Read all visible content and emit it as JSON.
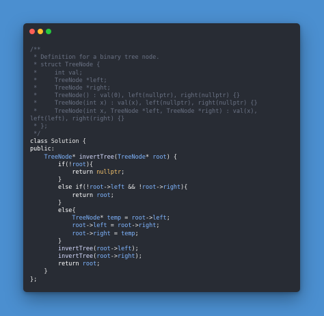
{
  "code_lines": [
    [
      {
        "t": "/**",
        "c": "cm"
      }
    ],
    [
      {
        "t": " * Definition for a binary tree node.",
        "c": "cm"
      }
    ],
    [
      {
        "t": " * struct TreeNode {",
        "c": "cm"
      }
    ],
    [
      {
        "t": " *     int val;",
        "c": "cm"
      }
    ],
    [
      {
        "t": " *     TreeNode *left;",
        "c": "cm"
      }
    ],
    [
      {
        "t": " *     TreeNode *right;",
        "c": "cm"
      }
    ],
    [
      {
        "t": " *     TreeNode() : val(0), left(nullptr), right(nullptr) {}",
        "c": "cm"
      }
    ],
    [
      {
        "t": " *     TreeNode(int x) : val(x), left(nullptr), right(nullptr) {}",
        "c": "cm"
      }
    ],
    [
      {
        "t": " *     TreeNode(int x, TreeNode *left, TreeNode *right) : val(x),",
        "c": "cm"
      }
    ],
    [
      {
        "t": "left(left), right(right) {}",
        "c": "cm"
      }
    ],
    [
      {
        "t": " * };",
        "c": "cm"
      }
    ],
    [
      {
        "t": " */",
        "c": "cm"
      }
    ],
    [
      {
        "t": "class",
        "c": "kw"
      },
      {
        "t": " Solution {",
        "c": "pl"
      }
    ],
    [
      {
        "t": "public",
        "c": "kw"
      },
      {
        "t": ":",
        "c": "pl"
      }
    ],
    [
      {
        "t": "    ",
        "c": "pl"
      },
      {
        "t": "TreeNode",
        "c": "ty"
      },
      {
        "t": "* ",
        "c": "pl"
      },
      {
        "t": "invertTree",
        "c": "fn"
      },
      {
        "t": "(",
        "c": "pl"
      },
      {
        "t": "TreeNode",
        "c": "ty"
      },
      {
        "t": "* ",
        "c": "pl"
      },
      {
        "t": "root",
        "c": "ty"
      },
      {
        "t": ") {",
        "c": "pl"
      }
    ],
    [
      {
        "t": "        ",
        "c": "pl"
      },
      {
        "t": "if",
        "c": "kw"
      },
      {
        "t": "(!",
        "c": "pl"
      },
      {
        "t": "root",
        "c": "ty"
      },
      {
        "t": "){",
        "c": "pl"
      }
    ],
    [
      {
        "t": "            ",
        "c": "pl"
      },
      {
        "t": "return",
        "c": "kw"
      },
      {
        "t": " ",
        "c": "pl"
      },
      {
        "t": "nullptr",
        "c": "nu"
      },
      {
        "t": ";",
        "c": "pl"
      }
    ],
    [
      {
        "t": "        }",
        "c": "pl"
      }
    ],
    [
      {
        "t": "        ",
        "c": "pl"
      },
      {
        "t": "else if",
        "c": "kw"
      },
      {
        "t": "(!",
        "c": "pl"
      },
      {
        "t": "root",
        "c": "ty"
      },
      {
        "t": "->",
        "c": "pl"
      },
      {
        "t": "left",
        "c": "ty"
      },
      {
        "t": " && !",
        "c": "pl"
      },
      {
        "t": "root",
        "c": "ty"
      },
      {
        "t": "->",
        "c": "pl"
      },
      {
        "t": "right",
        "c": "ty"
      },
      {
        "t": "){",
        "c": "pl"
      }
    ],
    [
      {
        "t": "            ",
        "c": "pl"
      },
      {
        "t": "return",
        "c": "kw"
      },
      {
        "t": " ",
        "c": "pl"
      },
      {
        "t": "root",
        "c": "ty"
      },
      {
        "t": ";",
        "c": "pl"
      }
    ],
    [
      {
        "t": "        }",
        "c": "pl"
      }
    ],
    [
      {
        "t": "        ",
        "c": "pl"
      },
      {
        "t": "else",
        "c": "kw"
      },
      {
        "t": "{",
        "c": "pl"
      }
    ],
    [
      {
        "t": "            ",
        "c": "pl"
      },
      {
        "t": "TreeNode",
        "c": "ty"
      },
      {
        "t": "* ",
        "c": "pl"
      },
      {
        "t": "temp",
        "c": "ty"
      },
      {
        "t": " = ",
        "c": "pl"
      },
      {
        "t": "root",
        "c": "ty"
      },
      {
        "t": "->",
        "c": "pl"
      },
      {
        "t": "left",
        "c": "ty"
      },
      {
        "t": ";",
        "c": "pl"
      }
    ],
    [
      {
        "t": "            ",
        "c": "pl"
      },
      {
        "t": "root",
        "c": "ty"
      },
      {
        "t": "->",
        "c": "pl"
      },
      {
        "t": "left",
        "c": "ty"
      },
      {
        "t": " = ",
        "c": "pl"
      },
      {
        "t": "root",
        "c": "ty"
      },
      {
        "t": "->",
        "c": "pl"
      },
      {
        "t": "right",
        "c": "ty"
      },
      {
        "t": ";",
        "c": "pl"
      }
    ],
    [
      {
        "t": "            ",
        "c": "pl"
      },
      {
        "t": "root",
        "c": "ty"
      },
      {
        "t": "->",
        "c": "pl"
      },
      {
        "t": "right",
        "c": "ty"
      },
      {
        "t": " = ",
        "c": "pl"
      },
      {
        "t": "temp",
        "c": "ty"
      },
      {
        "t": ";",
        "c": "pl"
      }
    ],
    [
      {
        "t": "        }",
        "c": "pl"
      }
    ],
    [
      {
        "t": "        ",
        "c": "pl"
      },
      {
        "t": "invertTree",
        "c": "fn"
      },
      {
        "t": "(",
        "c": "pl"
      },
      {
        "t": "root",
        "c": "ty"
      },
      {
        "t": "->",
        "c": "pl"
      },
      {
        "t": "left",
        "c": "ty"
      },
      {
        "t": ");",
        "c": "pl"
      }
    ],
    [
      {
        "t": "        ",
        "c": "pl"
      },
      {
        "t": "invertTree",
        "c": "fn"
      },
      {
        "t": "(",
        "c": "pl"
      },
      {
        "t": "root",
        "c": "ty"
      },
      {
        "t": "->",
        "c": "pl"
      },
      {
        "t": "right",
        "c": "ty"
      },
      {
        "t": ");",
        "c": "pl"
      }
    ],
    [
      {
        "t": "        ",
        "c": "pl"
      },
      {
        "t": "return",
        "c": "kw"
      },
      {
        "t": " ",
        "c": "pl"
      },
      {
        "t": "root",
        "c": "ty"
      },
      {
        "t": ";",
        "c": "pl"
      }
    ],
    [
      {
        "t": "    }",
        "c": "pl"
      }
    ],
    [
      {
        "t": "};",
        "c": "pl"
      }
    ]
  ]
}
